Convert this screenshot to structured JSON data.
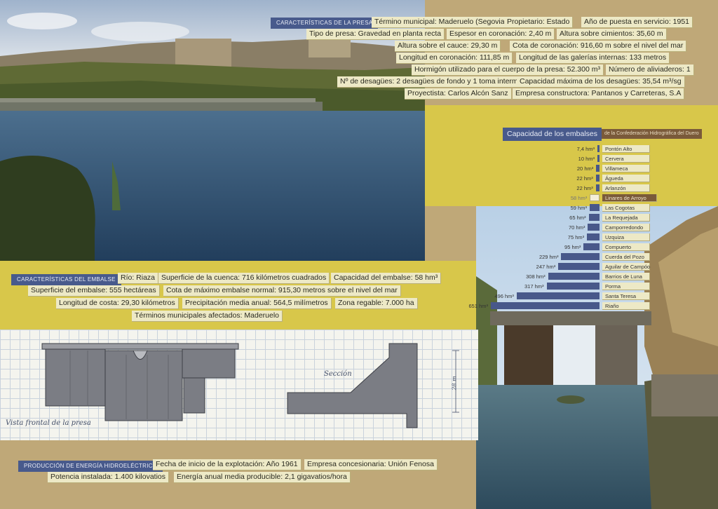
{
  "presa": {
    "header": "Características de la presa",
    "labels": [
      "Término municipal: Maderuelo (Segovia)",
      "Propietario: Estado",
      "Año de puesta en servicio: 1951",
      "Tipo de presa: Gravedad en planta recta",
      "Espesor en coronación: 2,40 m",
      "Altura sobre cimientos: 35,60 m",
      "Altura sobre el cauce: 29,30 m",
      "Cota de coronación: 916,60 m sobre el nivel del mar",
      "Longitud en coronación: 111,85 m",
      "Longitud de las galerías internas: 133 metros",
      "Hormigón utilizado para el cuerpo de la presa: 52.300 m³",
      "Número de aliviaderos: 1",
      "Nº de desagües: 2 desagües de fondo y 1 toma intermedia",
      "Capacidad máxima de los desagües: 35,54 m³/sg",
      "Proyectista: Carlos Alcón Sanz",
      "Empresa constructora: Pantanos y Carreteras, S.A"
    ]
  },
  "embalse": {
    "header": "Características del embalse",
    "labels": [
      "Río: Riaza",
      "Superficie de la cuenca: 716 kilómetros cuadrados",
      "Capacidad del embalse: 58 hm³",
      "Superficie del embalse: 555 hectáreas",
      "Cota de máximo embalse normal: 915,30 metros sobre el nivel del mar",
      "Longitud de costa: 29,30 kilómetros",
      "Precipitación media anual: 564,5 milímetros",
      "Zona regable: 7.000 ha",
      "Términos municipales afectados: Maderuelo"
    ]
  },
  "energia": {
    "header": "Producción de energía hidroeléctrica",
    "labels": [
      "Fecha de inicio de la explotación: Año 1961",
      "Empresa concesionaria: Unión Fenosa",
      "Potencia instalada: 1.400 kilovatios",
      "Energía anual media producible: 2,1 gigavatios/hora"
    ]
  },
  "drawing": {
    "front_caption": "Vista frontal de la presa",
    "section_caption": "Sección",
    "height_label": "28 m"
  },
  "chart_data": {
    "type": "bar",
    "title": "Capacidad de los embalses",
    "subtitle": "de la Confederación Hidrográfica del Duero",
    "unit": "hm³",
    "highlight": "Linares de Arroyo",
    "categories": [
      "Pontón Alto",
      "Cervera",
      "Villameca",
      "Águeda",
      "Arlanzón",
      "Linares de Arroyo",
      "Las Cogotas",
      "La Requejada",
      "Camporredondo",
      "Uzquiza",
      "Compuerto",
      "Cuerda del Pozo",
      "Aguilar de Campóo",
      "Barrios de Luna",
      "Porma",
      "Santa Teresa",
      "Riaño"
    ],
    "value_labels": [
      "7,4 hm³",
      "10 hm³",
      "20 hm³",
      "22 hm³",
      "22 hm³",
      "58 hm³",
      "59 hm³",
      "65 hm³",
      "70 hm³",
      "75 hm³",
      "95 hm³",
      "229 hm³",
      "247 hm³",
      "308 hm³",
      "317 hm³",
      "496 hm³",
      "651 hm³"
    ],
    "values": [
      7.4,
      10,
      20,
      22,
      22,
      58,
      59,
      65,
      70,
      75,
      95,
      229,
      247,
      308,
      317,
      496,
      651
    ]
  },
  "colors": {
    "header_blue": "#485a8c",
    "yellow": "#d8c74a",
    "tan": "#bfa878",
    "label_cream": "#ede9c6",
    "highlight_brown": "#7a5a3a"
  }
}
